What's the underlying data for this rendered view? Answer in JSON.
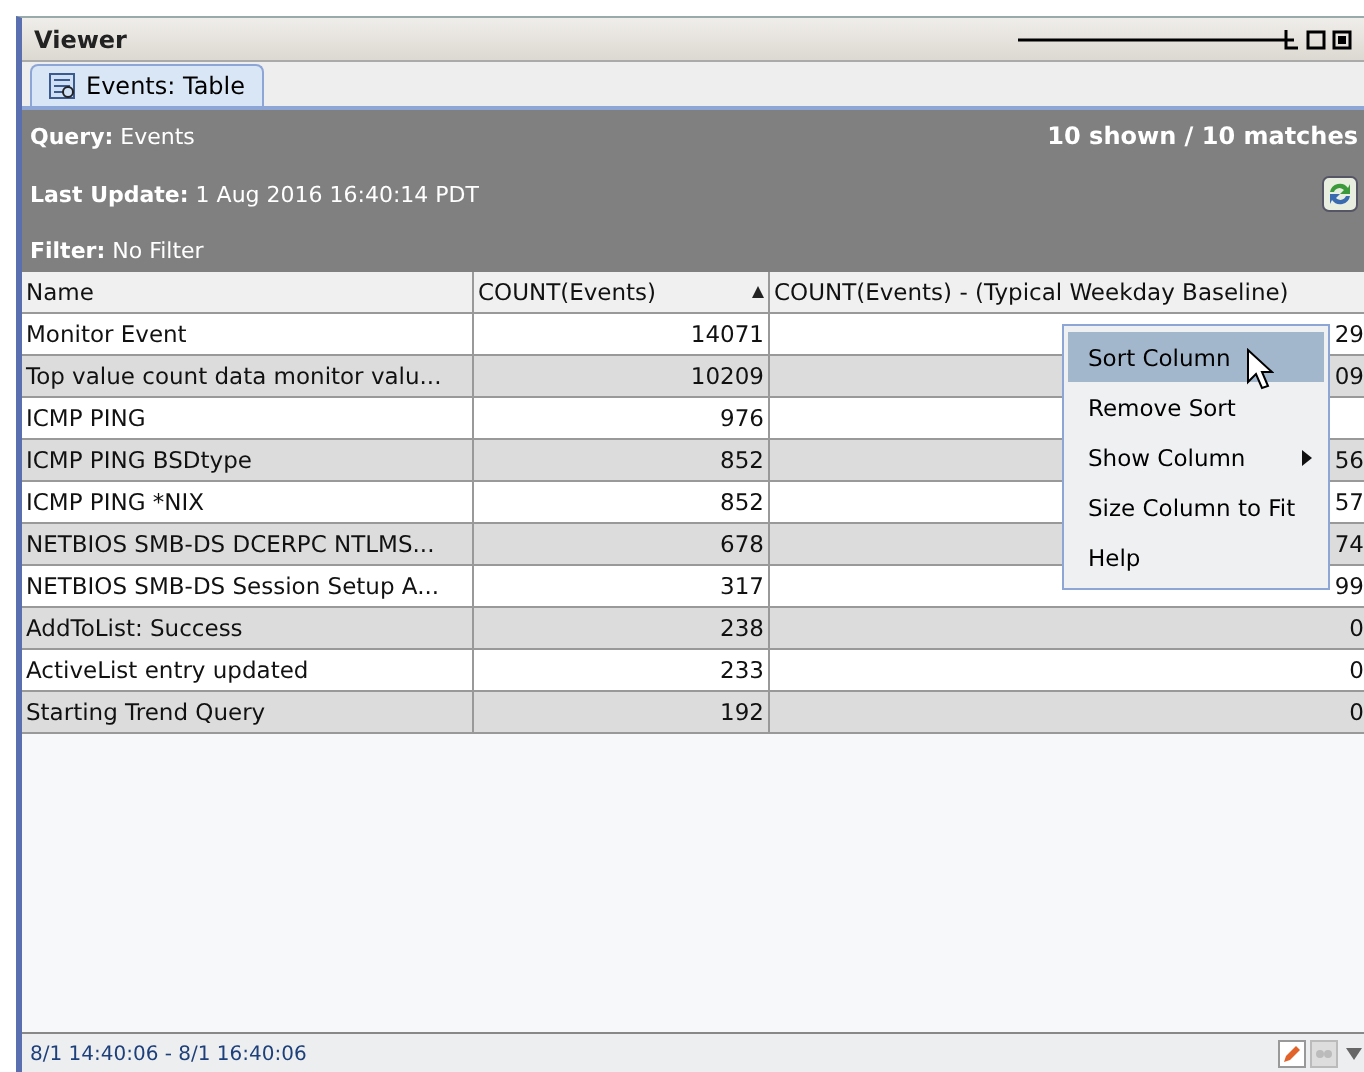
{
  "window": {
    "title": "Viewer"
  },
  "tabs": [
    {
      "label": "Events: Table",
      "selected": true
    }
  ],
  "query": {
    "query_label": "Query:",
    "query_value": "Events",
    "update_label": "Last Update:",
    "update_value": "1 Aug 2016 16:40:14 PDT",
    "filter_label": "Filter:",
    "filter_value": "No Filter",
    "matches": "10 shown / 10 matches"
  },
  "table": {
    "columns": [
      {
        "label": "Name",
        "sorted": false
      },
      {
        "label": "COUNT(Events)",
        "sorted": true
      },
      {
        "label": "COUNT(Events) - (Typical Weekday Baseline)",
        "sorted": false
      }
    ],
    "rows": [
      {
        "cells": [
          "Monitor Event",
          "14071",
          "29"
        ]
      },
      {
        "cells": [
          "Top value count data monitor valu...",
          "10209",
          "09"
        ]
      },
      {
        "cells": [
          "ICMP PING",
          "976"
        ]
      },
      {
        "cells": [
          "ICMP PING BSDtype",
          "852",
          "56"
        ]
      },
      {
        "cells": [
          "ICMP PING *NIX",
          "852",
          "57"
        ]
      },
      {
        "cells": [
          "NETBIOS SMB-DS DCERPC NTLMS...",
          "678",
          "74"
        ]
      },
      {
        "cells": [
          "NETBIOS SMB-DS Session Setup A...",
          "317",
          "99"
        ]
      },
      {
        "cells": [
          "AddToList: Success",
          "238",
          "0"
        ]
      },
      {
        "cells": [
          "ActiveList entry updated",
          "233",
          "0"
        ]
      },
      {
        "cells": [
          "Starting Trend Query",
          "192",
          "0"
        ]
      }
    ]
  },
  "context_menu": {
    "items": [
      {
        "label": "Sort Column",
        "selected": true,
        "submenu": false
      },
      {
        "label": "Remove Sort",
        "selected": false,
        "submenu": false
      },
      {
        "label": "Show Column",
        "selected": false,
        "submenu": true
      },
      {
        "label": "Size Column to Fit",
        "selected": false,
        "submenu": false
      },
      {
        "label": "Help",
        "selected": false,
        "submenu": false
      }
    ]
  },
  "status_bar": {
    "range": "8/1 14:40:06 - 8/1 16:40:06"
  }
}
